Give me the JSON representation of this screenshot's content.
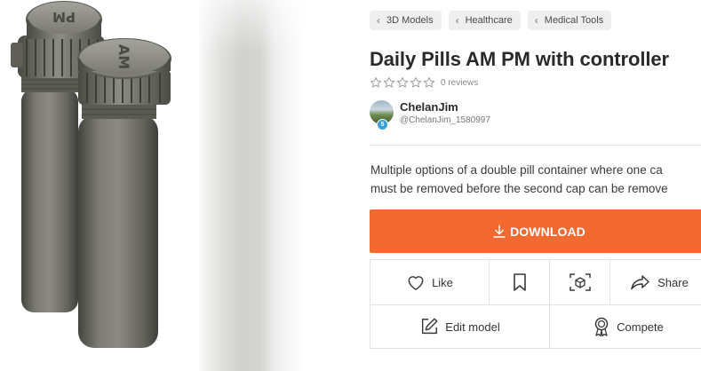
{
  "breadcrumbs": [
    "3D Models",
    "Healthcare",
    "Medical Tools"
  ],
  "title": "Daily Pills AM PM with controller",
  "rating": {
    "stars": 0,
    "max": 5,
    "reviews_text": "0 reviews"
  },
  "author": {
    "name": "ChelanJim",
    "handle": "@ChelanJim_1580997",
    "level": "5"
  },
  "description": [
    "Multiple options of a double pill container where one ca",
    "must be removed before the second cap can be remove"
  ],
  "download_label": "DOWNLOAD",
  "actions": {
    "like": "Like",
    "share": "Share",
    "edit": "Edit model",
    "compete": "Compete"
  },
  "bottle_cap_text": {
    "left": "PM",
    "right": "AM"
  },
  "colors": {
    "accent": "#f26a30",
    "bottle": "#6e6e66",
    "crumb_bg": "#efefef"
  }
}
